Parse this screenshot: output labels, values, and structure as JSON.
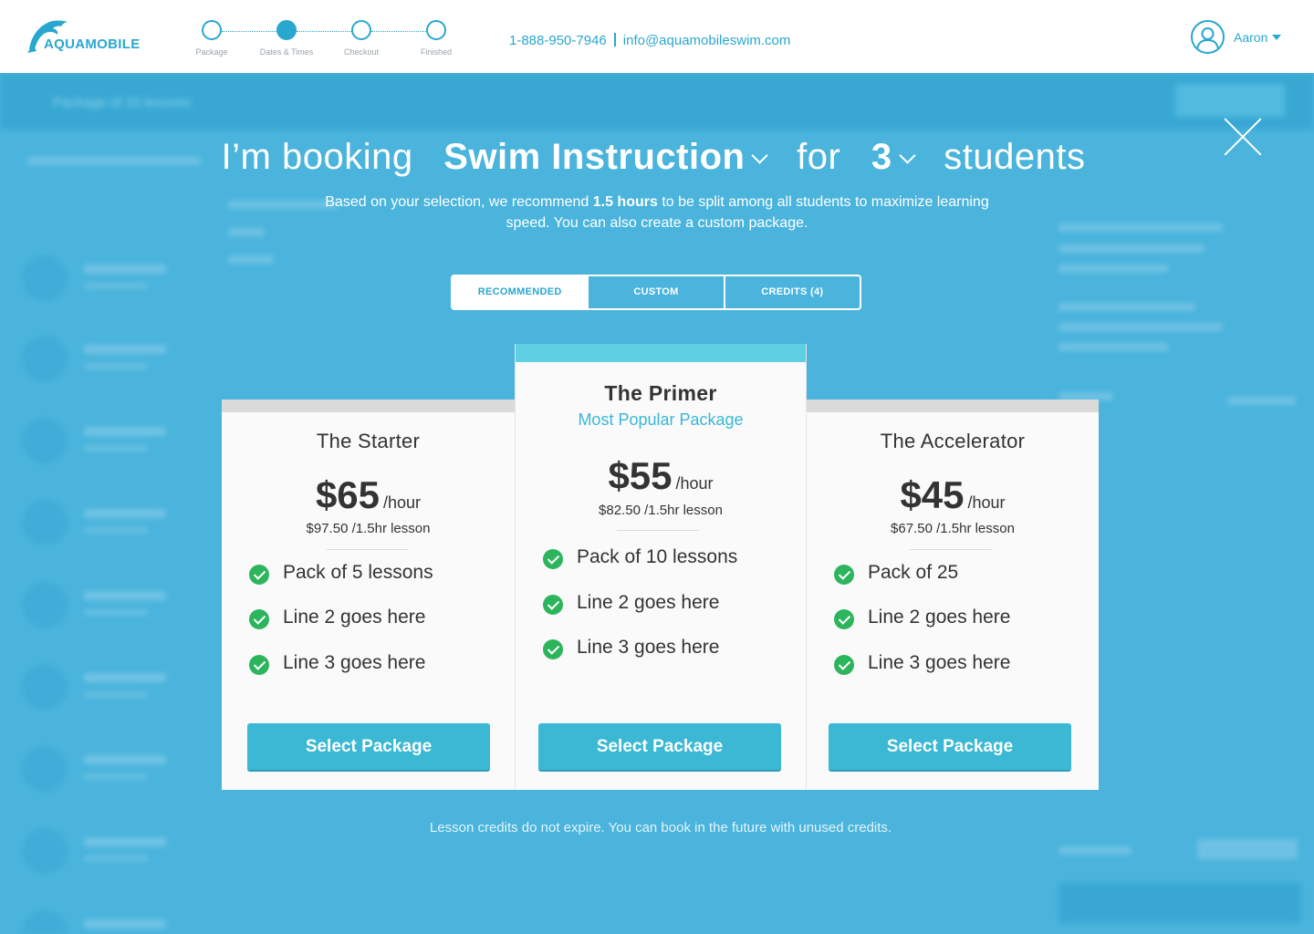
{
  "header": {
    "logo_text": "AQUAMOBILE",
    "steps": [
      {
        "label": "Package",
        "state": "done"
      },
      {
        "label": "Dates & Times",
        "state": "active"
      },
      {
        "label": "Checkout",
        "state": "pending"
      },
      {
        "label": "Finished",
        "state": "pending"
      }
    ],
    "phone": "1-888-950-7946",
    "email": "info@aquamobileswim.com",
    "user_name": "Aaron"
  },
  "background": {
    "bar_text": "Package of 10 lessons"
  },
  "modal": {
    "headline": {
      "prefix": "I’m booking",
      "service": "Swim Instruction",
      "middle": "for",
      "count": "3",
      "suffix": "students"
    },
    "subline_before": "Based on your selection, we recommend ",
    "subline_bold": "1.5 hours",
    "subline_after": " to be split among all students to maximize learning speed. You can also create a custom package.",
    "tabs": [
      {
        "label": "RECOMMENDED",
        "active": true
      },
      {
        "label": "CUSTOM",
        "active": false
      },
      {
        "label": "CREDITS (4)",
        "active": false
      }
    ],
    "cards": [
      {
        "title": "The Starter",
        "subtitle": "",
        "price": "$65",
        "per": "/hour",
        "lesson": "$97.50 /1.5hr lesson",
        "features": [
          "Pack of 5 lessons",
          "Line 2 goes here",
          "Line 3 goes here"
        ],
        "button": "Select Package"
      },
      {
        "title": "The Primer",
        "subtitle": "Most Popular Package",
        "price": "$55",
        "per": "/hour",
        "lesson": "$82.50 /1.5hr lesson",
        "features": [
          "Pack of 10 lessons",
          "Line 2 goes here",
          "Line 3 goes here"
        ],
        "button": "Select Package"
      },
      {
        "title": "The Accelerator",
        "subtitle": "",
        "price": "$45",
        "per": "/hour",
        "lesson": "$67.50 /1.5hr lesson",
        "features": [
          "Pack of 25",
          "Line 2 goes here",
          "Line 3 goes here"
        ],
        "button": "Select Package"
      }
    ],
    "footnote": "Lesson credits do not expire. You can book in the future with unused credits."
  },
  "colors": {
    "brand": "#2aa7cf",
    "overlay": "#4ab4dc",
    "button": "#3ab8d4",
    "check": "#2db55d",
    "popular_bar": "#5fcfe3"
  }
}
